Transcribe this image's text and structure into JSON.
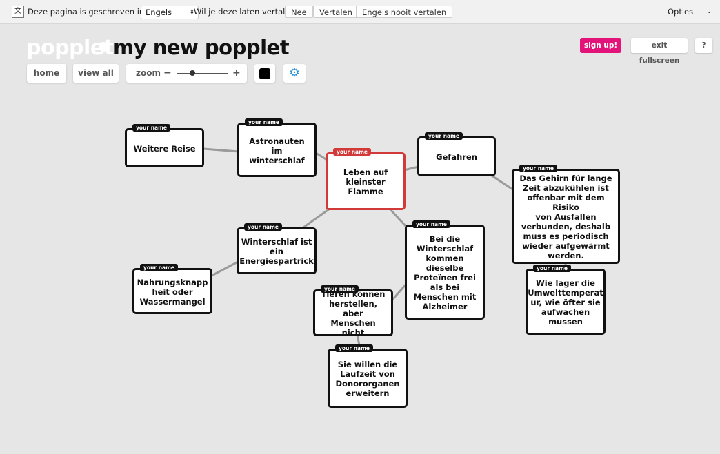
{
  "translate_bar": {
    "prefix": "Deze pagina is geschreven in het",
    "language_value": "Engels",
    "question": "Wil je deze laten vertalen?",
    "no_label": "Nee",
    "translate_label": "Vertalen",
    "never_label": "Engels nooit vertalen",
    "options_label": "Opties"
  },
  "header": {
    "logo": "popplet",
    "title": "my new popplet"
  },
  "toolbar": {
    "home": "home",
    "view_all": "view all",
    "zoom": "zoom",
    "zoom_minus": "−",
    "zoom_plus": "+",
    "zoom_level": 0.3
  },
  "top_right": {
    "sign_up": "sign up!",
    "exit_fullscreen": "exit fullscreen",
    "help": "?"
  },
  "colors": {
    "accent": "#e3137a",
    "selected_border": "#d23a3a",
    "canvas": "#e6e6e6"
  },
  "nodes": [
    {
      "tag": "your name",
      "text": "Weitere Reise"
    },
    {
      "tag": "your name",
      "text": "Astronauten im\nwinterschlaf"
    },
    {
      "tag": "your name",
      "text": "Leben auf\nkleinster Flamme"
    },
    {
      "tag": "your name",
      "text": "Gefahren"
    },
    {
      "tag": "your name",
      "text": "Das Gehirn für lange\nZeit abzukühlen ist\noffenbar mit dem Risiko\nvon Ausfallen\nverbunden, deshalb\nmuss es periodisch\nwieder aufgewärmt\nwerden."
    },
    {
      "tag": "your name",
      "text": "Winterschlaf ist\nein\nEnergiespartrick"
    },
    {
      "tag": "your name",
      "text": "Bei die\nWinterschlaf\nkommen\ndieselbe\nProteïnen frei\nals bei\nMenschen mit\nAlzheimer"
    },
    {
      "tag": "your name",
      "text": "Nahrungsknapp\nheit oder\nWassermangel"
    },
    {
      "tag": "your name",
      "text": "Wie lager die\nUmwelttemperat\nur, wie öfter sie\naufwachen\nmussen"
    },
    {
      "tag": "your name",
      "text": "Tieren können\nherstellen, aber\nMenschen nicht"
    },
    {
      "tag": "your name",
      "text": "Sie willen die\nLaufzeit von\nDonororganen\nerweitern"
    }
  ]
}
